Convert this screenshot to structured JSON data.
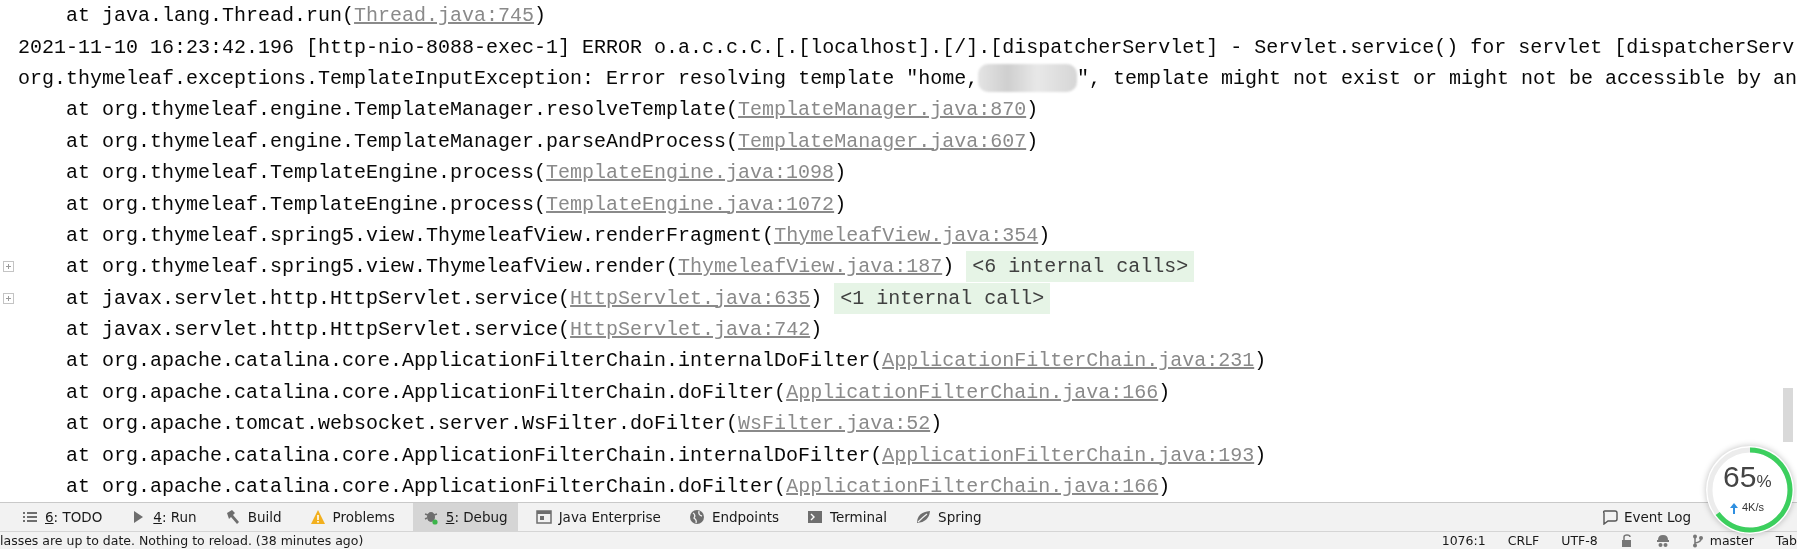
{
  "console": {
    "lines": [
      {
        "kind": "frame",
        "text": "at java.lang.Thread.run(",
        "link": "Thread.java:745",
        "after": ")"
      },
      {
        "kind": "message",
        "text": "2021-11-10 16:23:42.196 [http-nio-8088-exec-1] ERROR o.a.c.c.C.[.[localhost].[/].[dispatcherServlet] - Servlet.service() for servlet [dispatcherServ"
      },
      {
        "kind": "redacted-message",
        "text": "org.thymeleaf.exceptions.TemplateInputException: Error resolving template \"home,",
        "after": "\", template might not exist or might not be accessible by an"
      },
      {
        "kind": "frame",
        "text": "at org.thymeleaf.engine.TemplateManager.resolveTemplate(",
        "link": "TemplateManager.java:870",
        "after": ")"
      },
      {
        "kind": "frame",
        "text": "at org.thymeleaf.engine.TemplateManager.parseAndProcess(",
        "link": "TemplateManager.java:607",
        "after": ")"
      },
      {
        "kind": "frame",
        "text": "at org.thymeleaf.TemplateEngine.process(",
        "link": "TemplateEngine.java:1098",
        "after": ")"
      },
      {
        "kind": "frame",
        "text": "at org.thymeleaf.TemplateEngine.process(",
        "link": "TemplateEngine.java:1072",
        "after": ")"
      },
      {
        "kind": "frame",
        "text": "at org.thymeleaf.spring5.view.ThymeleafView.renderFragment(",
        "link": "ThymeleafView.java:354",
        "after": ")"
      },
      {
        "kind": "folded-frame",
        "text": "at org.thymeleaf.spring5.view.ThymeleafView.render(",
        "link": "ThymeleafView.java:187",
        "after": ")",
        "note": "<6 internal calls>"
      },
      {
        "kind": "folded-frame",
        "text": "at javax.servlet.http.HttpServlet.service(",
        "link": "HttpServlet.java:635",
        "after": ")",
        "note": "<1 internal call>"
      },
      {
        "kind": "frame",
        "text": "at javax.servlet.http.HttpServlet.service(",
        "link": "HttpServlet.java:742",
        "after": ")"
      },
      {
        "kind": "frame",
        "text": "at org.apache.catalina.core.ApplicationFilterChain.internalDoFilter(",
        "link": "ApplicationFilterChain.java:231",
        "after": ")"
      },
      {
        "kind": "frame",
        "text": "at org.apache.catalina.core.ApplicationFilterChain.doFilter(",
        "link": "ApplicationFilterChain.java:166",
        "after": ")"
      },
      {
        "kind": "frame",
        "text": "at org.apache.tomcat.websocket.server.WsFilter.doFilter(",
        "link": "WsFilter.java:52",
        "after": ")"
      },
      {
        "kind": "frame",
        "text": "at org.apache.catalina.core.ApplicationFilterChain.internalDoFilter(",
        "link": "ApplicationFilterChain.java:193",
        "after": ")"
      },
      {
        "kind": "frame",
        "text": "at org.apache.catalina.core.ApplicationFilterChain.doFilter(",
        "link": "ApplicationFilterChain.java:166",
        "after": ")"
      }
    ]
  },
  "tool_tabs": [
    {
      "kind": "list",
      "key": "6",
      "label": ": TODO",
      "selected": false
    },
    {
      "kind": "run",
      "key": "4",
      "label": ": Run",
      "selected": false
    },
    {
      "kind": "build",
      "label": "Build",
      "selected": false
    },
    {
      "kind": "warning",
      "label": "Problems",
      "selected": false
    },
    {
      "kind": "debug",
      "key": "5",
      "label": ": Debug",
      "selected": true
    },
    {
      "kind": "enterprise",
      "label": "Java Enterprise",
      "selected": false
    },
    {
      "kind": "globe",
      "label": "Endpoints",
      "selected": false
    },
    {
      "kind": "terminal",
      "label": "Terminal",
      "selected": false
    },
    {
      "kind": "leaf",
      "label": "Spring",
      "selected": false
    }
  ],
  "event_log": {
    "label": "Event Log"
  },
  "status_bar": {
    "message": "lasses are up to date. Nothing to reload. (38 minutes ago)",
    "position": "1076:1",
    "line_separator": "CRLF",
    "encoding": "UTF-8",
    "branch": "master",
    "indent": "Tab"
  },
  "network_meter": {
    "reading": "65",
    "unit": "%",
    "speed": "4K/s"
  }
}
